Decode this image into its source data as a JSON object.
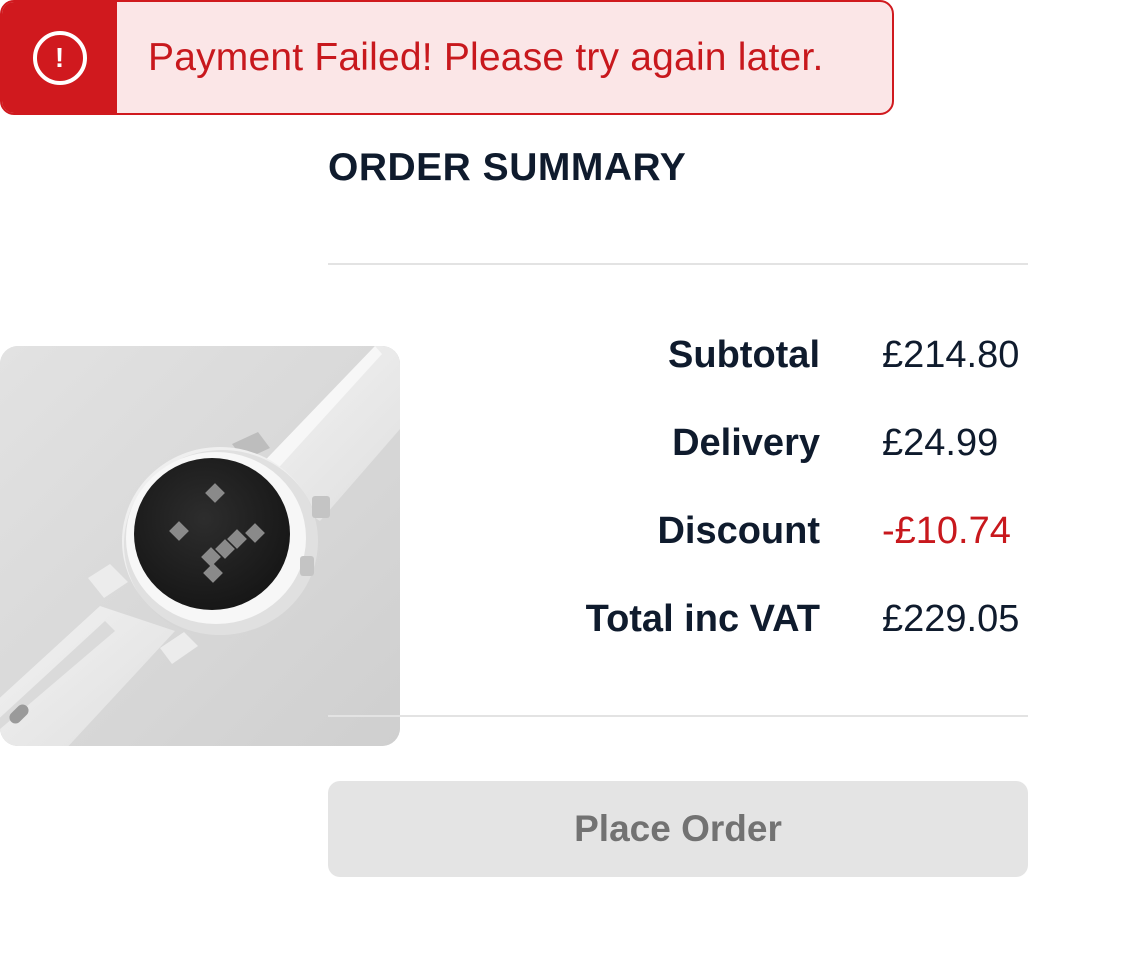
{
  "toast": {
    "icon": "alert-circle-icon",
    "message": "Payment Failed! Please try again later.",
    "colors": {
      "border": "#d0191e",
      "background": "#fbe6e7",
      "text": "#c8181d"
    }
  },
  "summary": {
    "title": "ORDER SUMMARY",
    "rows": [
      {
        "label": "Subtotal",
        "value": "£214.80"
      },
      {
        "label": "Delivery",
        "value": "£24.99"
      },
      {
        "label": "Discount",
        "value": "-£10.74"
      },
      {
        "label": "Total inc VAT",
        "value": "£229.05"
      }
    ]
  },
  "product": {
    "image_subject": "smartwatch-image"
  },
  "actions": {
    "place_order_label": "Place Order",
    "place_order_disabled": true
  }
}
